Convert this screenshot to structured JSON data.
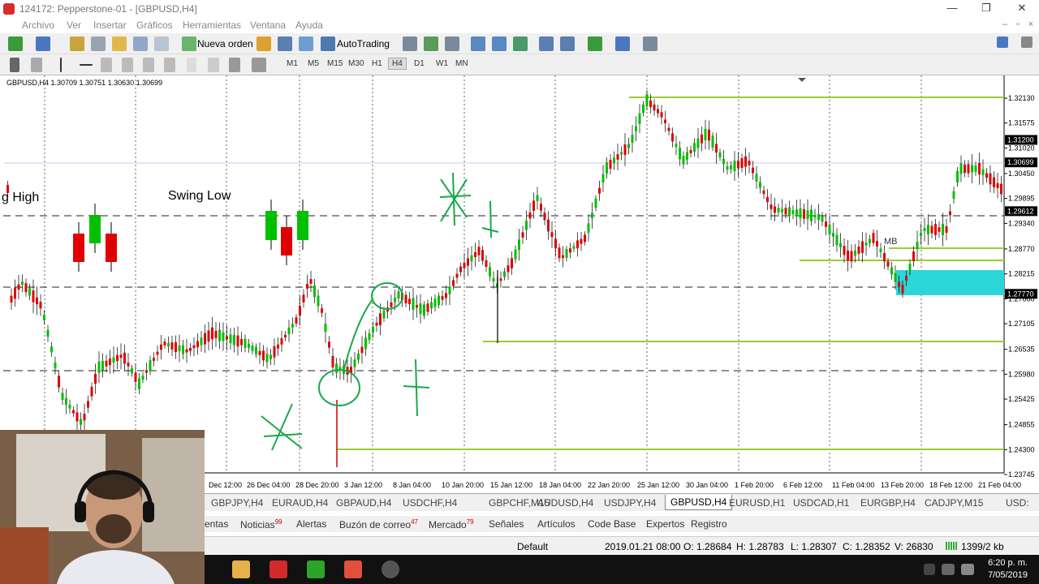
{
  "window": {
    "title": "124172: Pepperstone-01 - [GBPUSD,H4]"
  },
  "menu": [
    "Archivo",
    "Ver",
    "Insertar",
    "Gráficos",
    "Herramientas",
    "Ventana",
    "Ayuda"
  ],
  "toolbar": {
    "new_order": "Nueva orden",
    "autotrading": "AutoTrading"
  },
  "timeframes": [
    "M1",
    "M5",
    "M15",
    "M30",
    "H1",
    "H4",
    "D1",
    "W1",
    "MN"
  ],
  "active_timeframe": "H4",
  "chart": {
    "info": "GBPUSD,H4  1.30709 1.30751 1.30630 1.30699",
    "annotations": {
      "swing_high": "g High",
      "swing_low": "Swing Low",
      "mb": "MB"
    },
    "price_ticks": [
      "1.32130",
      "1.31575",
      "1.31020",
      "1.30450",
      "1.29895",
      "1.29340",
      "1.28770",
      "1.28215",
      "1.27660",
      "1.27105",
      "1.26535",
      "1.25980",
      "1.25425",
      "1.24855",
      "1.24300",
      "1.23745"
    ],
    "price_markers": [
      "1.31200",
      "1.30699",
      "1.29612",
      "1.27770"
    ],
    "time_ticks": [
      "Dec 12:00",
      "26 Dec 04:00",
      "28 Dec 20:00",
      "3 Jan 12:00",
      "8 Jan 04:00",
      "10 Jan 20:00",
      "15 Jan 12:00",
      "18 Jan 04:00",
      "22 Jan 20:00",
      "25 Jan 12:00",
      "30 Jan 04:00",
      "1 Feb 20:00",
      "6 Feb 12:00",
      "11 Feb 04:00",
      "13 Feb 20:00",
      "18 Feb 12:00",
      "21 Feb 04:00"
    ],
    "colors": {
      "bull": "#00c000",
      "bear": "#e00000",
      "level": "#9acd32",
      "zone": "#2dd6d6",
      "marker_bg": "#000000"
    }
  },
  "symbol_tabs": [
    "GBPJPY,H4",
    "EURAUD,H4",
    "GBPAUD,H4",
    "USDCHF,H4",
    "GBPCHF,M15",
    "AUDUSD,H4",
    "USDJPY,H4",
    "GBPUSD,H4",
    "EURUSD,H1",
    "USDCAD,H1",
    "EURGBP,H4",
    "CADJPY,M15",
    "USD:"
  ],
  "active_symbol": "GBPUSD,H4",
  "terminal_tabs": [
    {
      "label": "entas",
      "badge": ""
    },
    {
      "label": "Noticias",
      "badge": "99"
    },
    {
      "label": "Alertas",
      "badge": ""
    },
    {
      "label": "Buzón de correo",
      "badge": "47"
    },
    {
      "label": "Mercado",
      "badge": "79"
    },
    {
      "label": "Señales",
      "badge": ""
    },
    {
      "label": "Artículos",
      "badge": ""
    },
    {
      "label": "Code Base",
      "badge": ""
    },
    {
      "label": "Expertos",
      "badge": ""
    },
    {
      "label": "Registro",
      "badge": ""
    }
  ],
  "status": {
    "profile": "Default",
    "datetime": "2019.01.21 08:00",
    "open": "O: 1.28684",
    "high": "H: 1.28783",
    "low": "L: 1.28307",
    "close": "C: 1.28352",
    "volume": "V: 26830",
    "traffic": "1399/2 kb"
  },
  "taskbar": {
    "time": "6:20 p. m.",
    "date": "7/05/2019"
  }
}
